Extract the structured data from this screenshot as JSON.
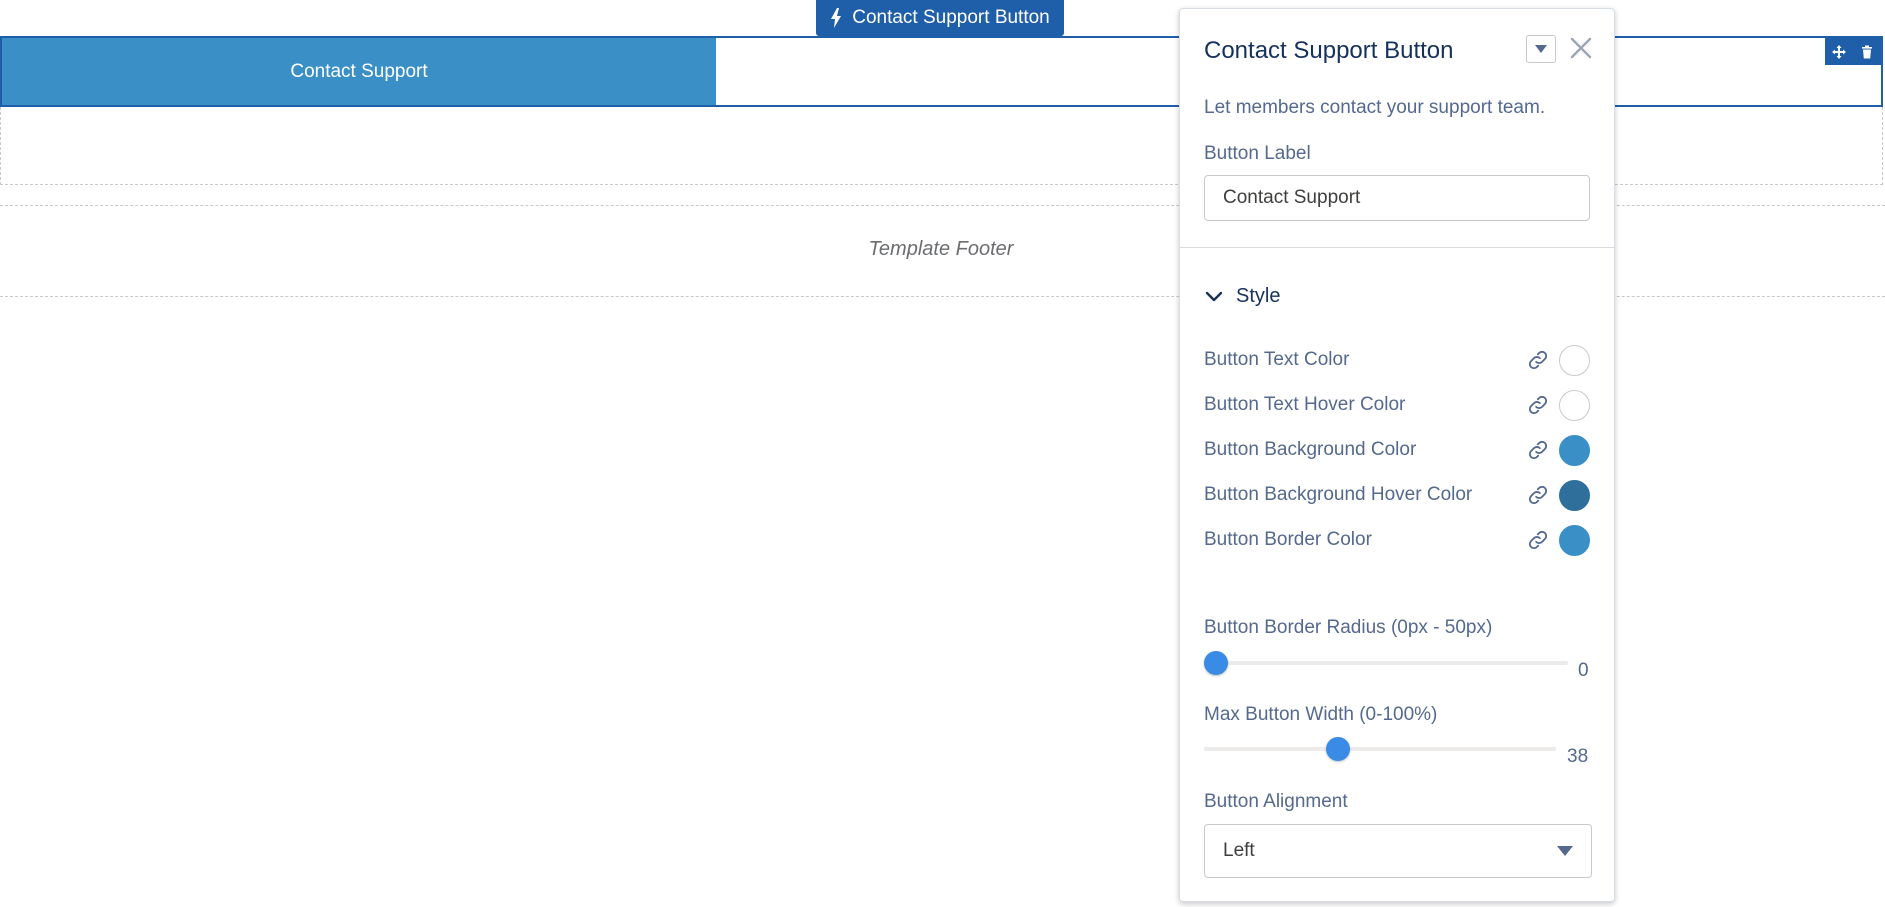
{
  "canvas": {
    "component_tab_label": "Contact Support Button",
    "button_label": "Contact Support",
    "footer_label": "Template Footer"
  },
  "panel": {
    "title": "Contact Support Button",
    "description": "Let members contact your support team.",
    "button_label_field": {
      "label": "Button Label",
      "value": "Contact Support"
    },
    "style_section": {
      "title": "Style",
      "expanded": true,
      "colors": [
        {
          "label": "Button Text Color",
          "swatch": "#ffffff"
        },
        {
          "label": "Button Text Hover Color",
          "swatch": "#ffffff"
        },
        {
          "label": "Button Background Color",
          "swatch": "#3a8fc7"
        },
        {
          "label": "Button Background Hover Color",
          "swatch": "#2e6f9c"
        },
        {
          "label": "Button Border Color",
          "swatch": "#3a8fc7"
        }
      ],
      "border_radius": {
        "label": "Button Border Radius (0px - 50px)",
        "min": 0,
        "max": 50,
        "value": 0,
        "value_text": "0"
      },
      "max_width": {
        "label": "Max Button Width (0-100%)",
        "min": 0,
        "max": 100,
        "value": 38,
        "value_text": "38"
      },
      "alignment": {
        "label": "Button Alignment",
        "selected": "Left"
      }
    }
  },
  "colors": {
    "brand_dark": "#1f5ea8",
    "button_blue": "#3a8fc7",
    "slider_thumb": "#3a8be5"
  },
  "icons": [
    "lightning-bolt-icon",
    "move-icon",
    "trash-icon",
    "chevron-down-icon",
    "close-icon",
    "link-icon",
    "caret-down-icon"
  ]
}
